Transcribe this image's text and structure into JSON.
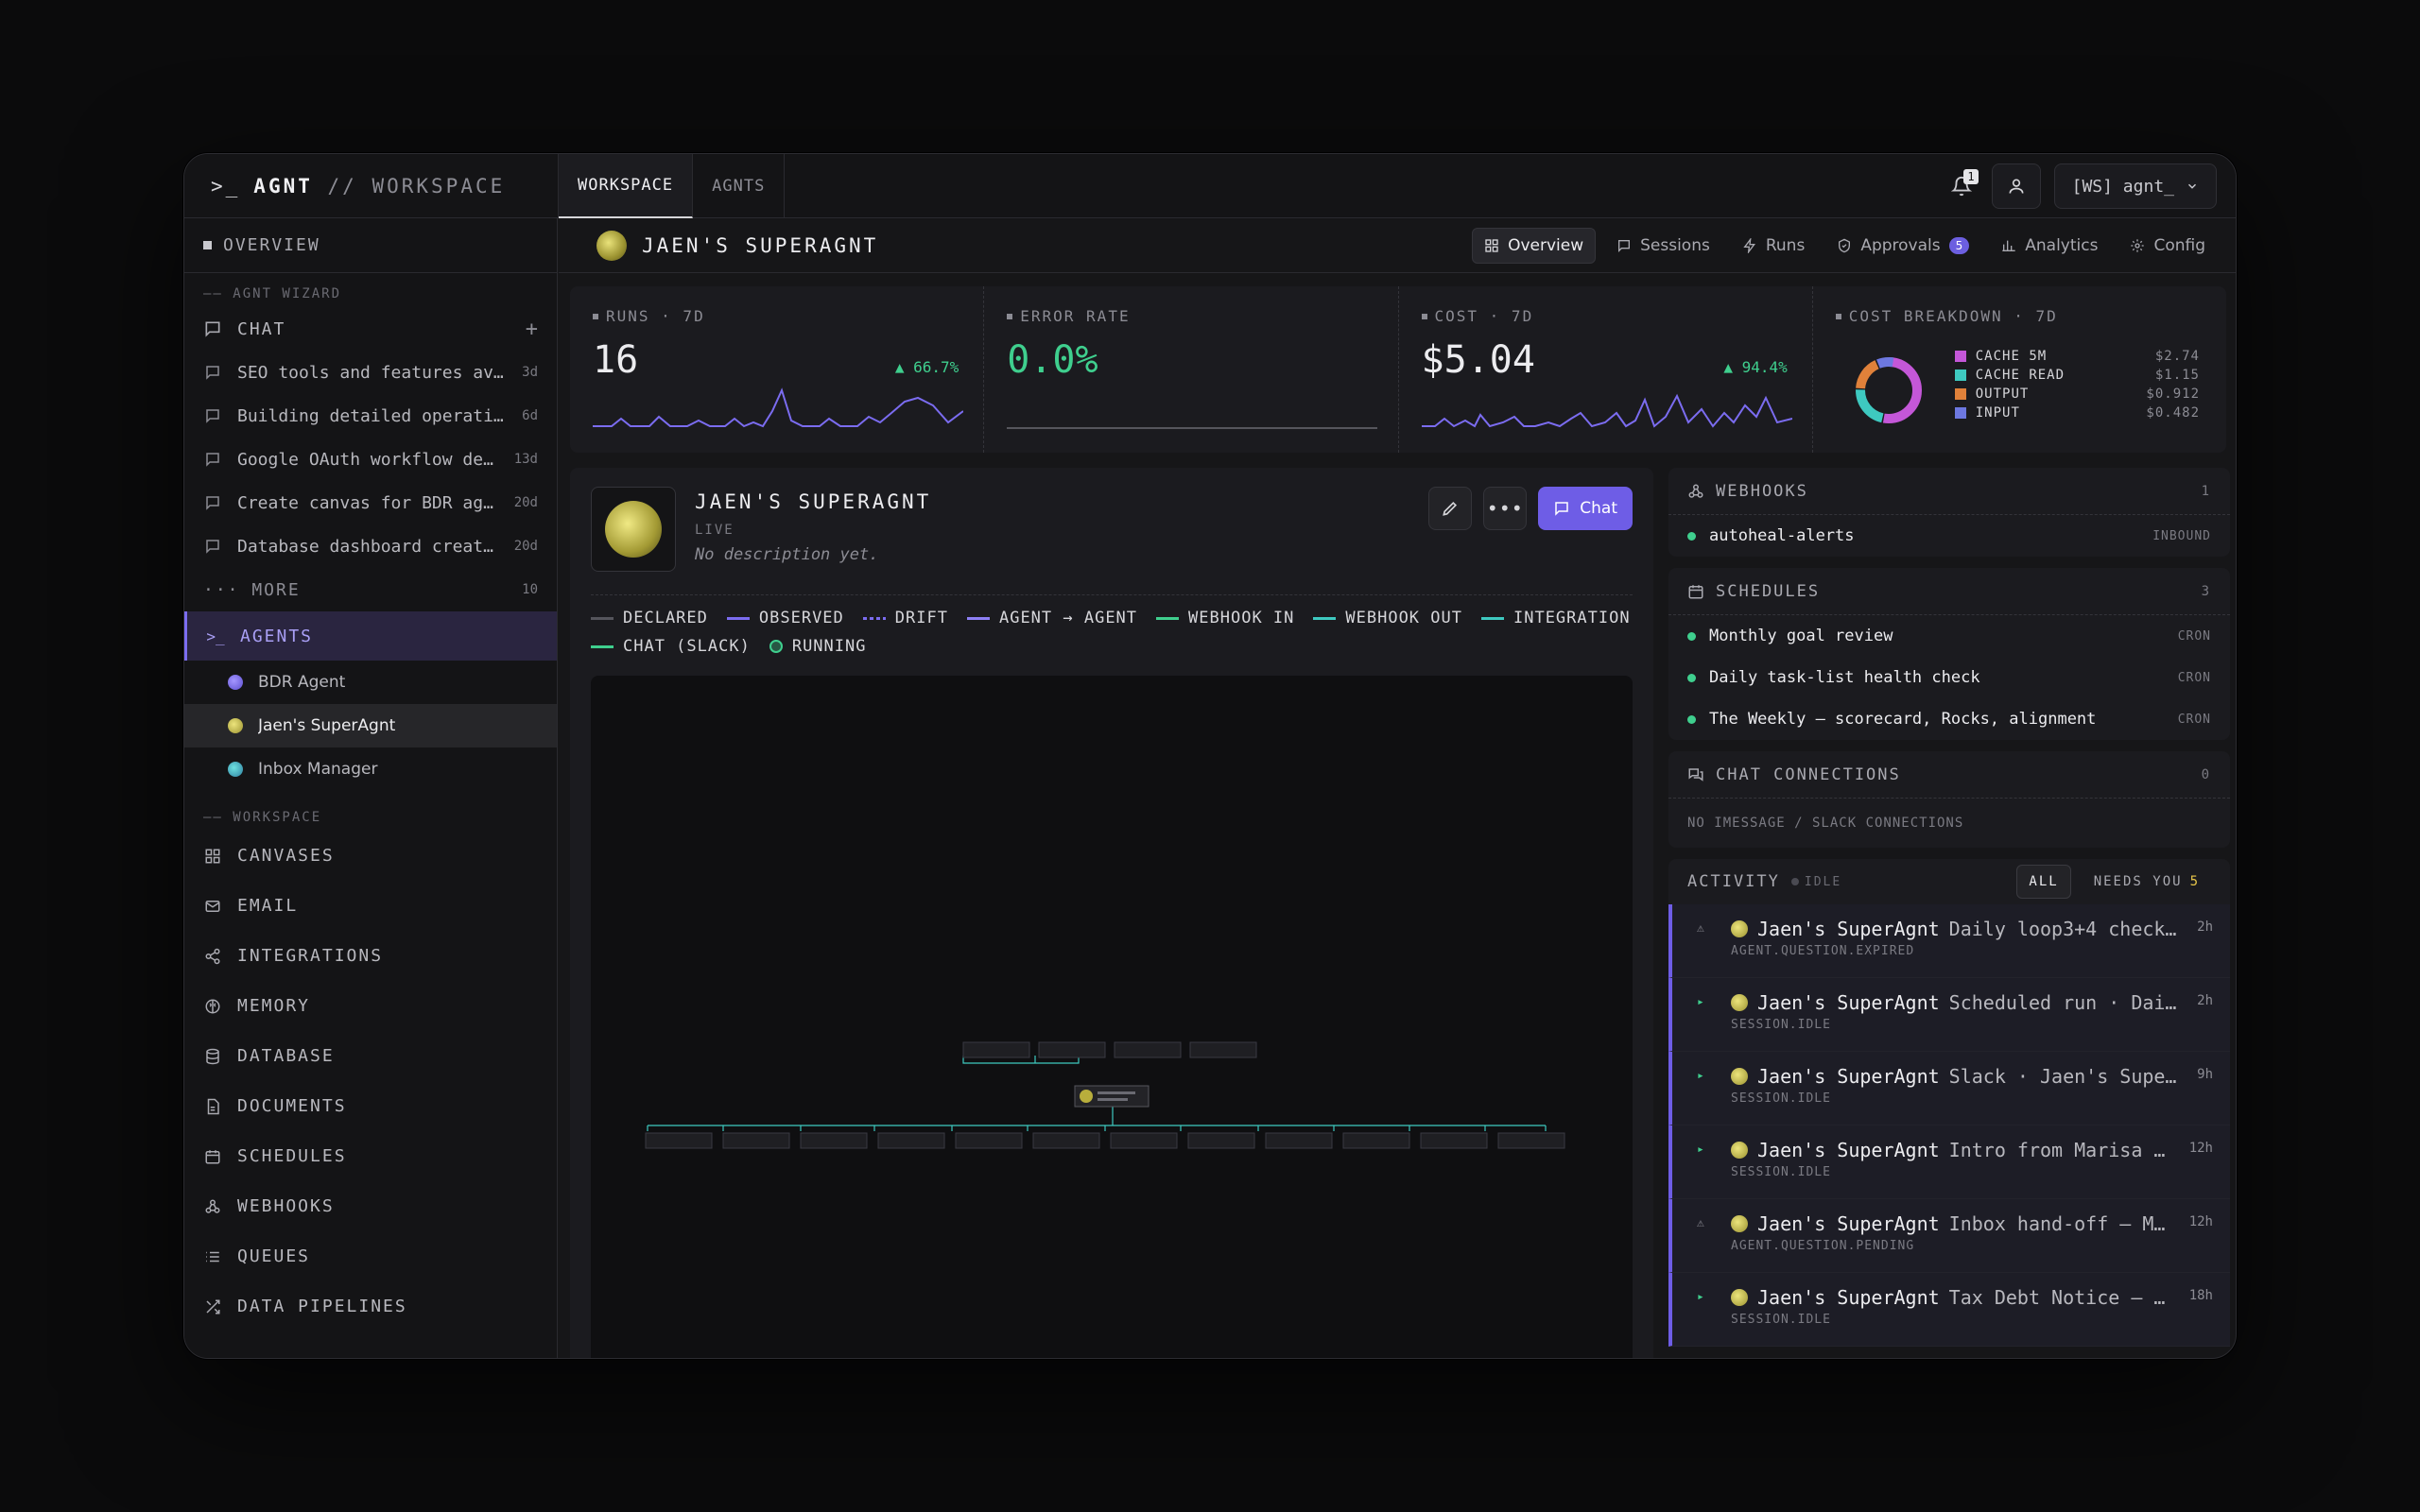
{
  "brand": {
    "prompt": ">_",
    "name": "AGNT",
    "suffix": "// WORKSPACE"
  },
  "topnav": {
    "tabs": [
      {
        "label": "WORKSPACE"
      },
      {
        "label": "AGNTS"
      }
    ],
    "notif_count": "1",
    "workspace": "[WS] agnt_"
  },
  "sidebar": {
    "overview": "OVERVIEW",
    "wizard_section": "—— AGNT WIZARD",
    "chat_label": "CHAT",
    "chats": [
      {
        "title": "SEO tools and features av…",
        "age": "3d"
      },
      {
        "title": "Building detailed operati…",
        "age": "6d"
      },
      {
        "title": "Google OAuth workflow dem…",
        "age": "13d"
      },
      {
        "title": "Create canvas for BDR age…",
        "age": "20d"
      },
      {
        "title": "Database dashboard creati…",
        "age": "20d"
      }
    ],
    "more_label": "··· MORE",
    "more_count": "10",
    "agents_label": "AGENTS",
    "agents": [
      {
        "name": "BDR Agent",
        "color": "#7b6cf0"
      },
      {
        "name": "Jaen's SuperAgnt",
        "color": "#c9bf45"
      },
      {
        "name": "Inbox Manager",
        "color": "#3aa6b3"
      }
    ],
    "workspace_section": "—— WORKSPACE",
    "nav": [
      {
        "label": "CANVASES",
        "icon": "grid-icon"
      },
      {
        "label": "EMAIL",
        "icon": "mail-icon"
      },
      {
        "label": "INTEGRATIONS",
        "icon": "share-icon"
      },
      {
        "label": "MEMORY",
        "icon": "brain-icon"
      },
      {
        "label": "DATABASE",
        "icon": "database-icon"
      },
      {
        "label": "DOCUMENTS",
        "icon": "document-icon"
      },
      {
        "label": "SCHEDULES",
        "icon": "calendar-icon"
      },
      {
        "label": "WEBHOOKS",
        "icon": "webhook-icon"
      },
      {
        "label": "QUEUES",
        "icon": "list-icon"
      },
      {
        "label": "DATA PIPELINES",
        "icon": "shuffle-icon"
      }
    ]
  },
  "subbar": {
    "title": "JAEN'S SUPERAGNT",
    "tabs": [
      {
        "label": "Overview"
      },
      {
        "label": "Sessions"
      },
      {
        "label": "Runs"
      },
      {
        "label": "Approvals",
        "badge": "5"
      },
      {
        "label": "Analytics"
      },
      {
        "label": "Config"
      }
    ]
  },
  "stats": {
    "runs": {
      "label": "RUNS · 7D",
      "value": "16",
      "delta": "▲ 66.7%"
    },
    "error": {
      "label": "ERROR RATE",
      "value": "0.0%"
    },
    "cost": {
      "label": "COST · 7D",
      "value": "$5.04",
      "delta": "▲ 94.4%"
    },
    "breakdown": {
      "label": "COST BREAKDOWN · 7D",
      "items": [
        {
          "label": "CACHE 5M",
          "amount": "$2.74",
          "color": "#c457d8",
          "share": 0.535
        },
        {
          "label": "CACHE READ",
          "amount": "$1.15",
          "color": "#3ec9c0",
          "share": 0.225
        },
        {
          "label": "OUTPUT",
          "amount": "$0.912",
          "color": "#e0813a",
          "share": 0.178
        },
        {
          "label": "INPUT",
          "amount": "$0.482",
          "color": "#6d78e0",
          "share": 0.094
        }
      ]
    }
  },
  "agent": {
    "name": "JAEN'S SUPERAGNT",
    "status": "LIVE",
    "description": "No description yet.",
    "chat_label": "Chat"
  },
  "legend": [
    {
      "label": "DECLARED",
      "color": "#55555c",
      "style": "solid"
    },
    {
      "label": "OBSERVED",
      "color": "#7b6cf0",
      "style": "solid"
    },
    {
      "label": "DRIFT",
      "color": "#7b6cf0",
      "style": "dashed"
    },
    {
      "label": "AGENT → AGENT",
      "color": "#8d7ff5",
      "style": "solid"
    },
    {
      "label": "WEBHOOK IN",
      "color": "#3fcf8e",
      "style": "solid"
    },
    {
      "label": "WEBHOOK OUT",
      "color": "#3ec9c0",
      "style": "solid"
    },
    {
      "label": "INTEGRATION",
      "color": "#3ec9c0",
      "style": "solid"
    },
    {
      "label": "CHAT (SLACK)",
      "color": "#3fcf8e",
      "style": "solid"
    },
    {
      "label": "RUNNING",
      "color": "#3fcf8e",
      "style": "dot"
    }
  ],
  "webhooks": {
    "label": "WEBHOOKS",
    "count": "1",
    "items": [
      {
        "name": "autoheal-alerts",
        "tag": "INBOUND"
      }
    ]
  },
  "schedules": {
    "label": "SCHEDULES",
    "count": "3",
    "items": [
      {
        "name": "Monthly goal review",
        "tag": "CRON"
      },
      {
        "name": "Daily task-list health check",
        "tag": "CRON"
      },
      {
        "name": "The Weekly — scorecard, Rocks, alignment",
        "tag": "CRON"
      }
    ]
  },
  "chat_connections": {
    "label": "CHAT CONNECTIONS",
    "count": "0",
    "empty": "NO IMESSAGE / SLACK CONNECTIONS"
  },
  "activity": {
    "label": "ACTIVITY",
    "state": "IDLE",
    "filters": [
      {
        "label": "ALL"
      },
      {
        "label": "NEEDS YOU",
        "count": "5"
      }
    ],
    "items": [
      {
        "who": "Jaen's SuperAgnt",
        "what": "Daily loop3+4 check…",
        "sub": "AGENT.QUESTION.EXPIRED",
        "time": "2h",
        "mark": "⚠",
        "kind": "warn"
      },
      {
        "who": "Jaen's SuperAgnt",
        "what": "Scheduled run · Dai…",
        "sub": "SESSION.IDLE",
        "time": "2h",
        "mark": "▸",
        "kind": "ok"
      },
      {
        "who": "Jaen's SuperAgnt",
        "what": "Slack · Jaen's Supe…",
        "sub": "SESSION.IDLE",
        "time": "9h",
        "mark": "▸",
        "kind": "ok"
      },
      {
        "who": "Jaen's SuperAgnt",
        "what": "Intro from Marisa …",
        "sub": "SESSION.IDLE",
        "time": "12h",
        "mark": "▸",
        "kind": "ok"
      },
      {
        "who": "Jaen's SuperAgnt",
        "what": "Inbox hand-off — M…",
        "sub": "AGENT.QUESTION.PENDING",
        "time": "12h",
        "mark": "⚠",
        "kind": "warn"
      },
      {
        "who": "Jaen's SuperAgnt",
        "what": "Tax Debt Notice — …",
        "sub": "SESSION.IDLE",
        "time": "18h",
        "mark": "▸",
        "kind": "ok"
      }
    ]
  }
}
